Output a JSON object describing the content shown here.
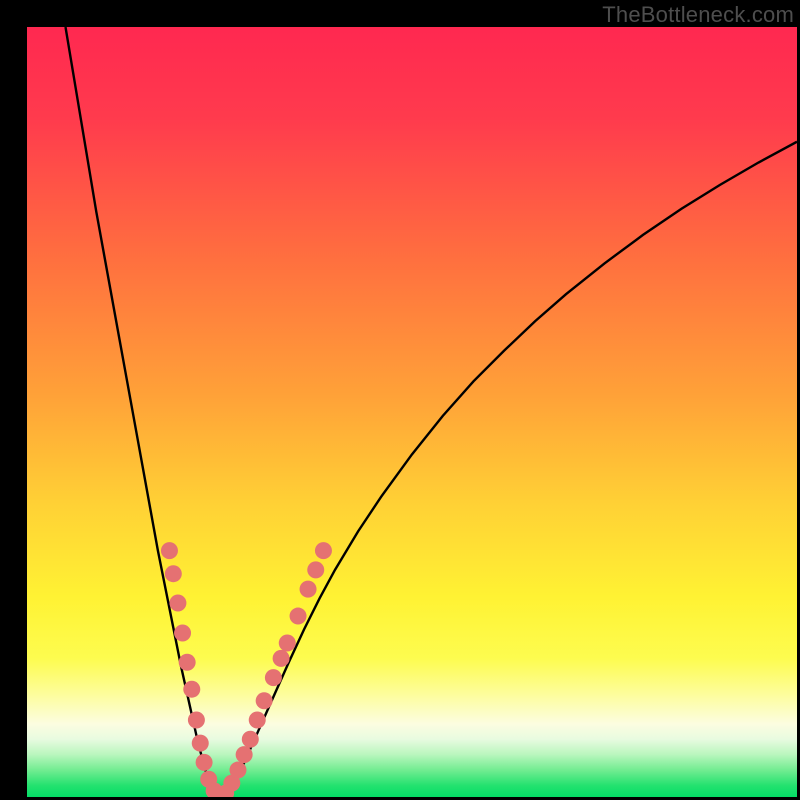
{
  "watermark": "TheBottleneck.com",
  "colors": {
    "frame": "#000000",
    "curve": "#000000",
    "marker": "#e57172",
    "gradient_stops": [
      {
        "offset": 0.0,
        "color": "#ff2850"
      },
      {
        "offset": 0.12,
        "color": "#ff3b4d"
      },
      {
        "offset": 0.3,
        "color": "#ff6f3f"
      },
      {
        "offset": 0.48,
        "color": "#ffa238"
      },
      {
        "offset": 0.62,
        "color": "#ffd135"
      },
      {
        "offset": 0.74,
        "color": "#fff233"
      },
      {
        "offset": 0.82,
        "color": "#fdfc4f"
      },
      {
        "offset": 0.865,
        "color": "#fdfd99"
      },
      {
        "offset": 0.905,
        "color": "#fcfde0"
      },
      {
        "offset": 0.925,
        "color": "#e8fbe0"
      },
      {
        "offset": 0.945,
        "color": "#b9f6bd"
      },
      {
        "offset": 0.965,
        "color": "#72ec91"
      },
      {
        "offset": 0.985,
        "color": "#24e26f"
      },
      {
        "offset": 1.0,
        "color": "#04dd66"
      }
    ]
  },
  "chart_data": {
    "type": "line",
    "title": "",
    "xlabel": "",
    "ylabel": "",
    "xlim": [
      0,
      100
    ],
    "ylim": [
      0,
      100
    ],
    "x": [
      5,
      6,
      7,
      8,
      9,
      10,
      11,
      12,
      13,
      14,
      15,
      16,
      17,
      18,
      19,
      20,
      21,
      22,
      23,
      24,
      25,
      26,
      28,
      30,
      32,
      34,
      36,
      38,
      40,
      43,
      46,
      50,
      54,
      58,
      62,
      66,
      70,
      75,
      80,
      85,
      90,
      95,
      100
    ],
    "values": [
      100,
      94,
      88,
      82,
      76,
      70.5,
      65,
      59.5,
      54,
      48.5,
      43,
      37.5,
      32,
      27,
      22,
      17,
      12.5,
      8,
      4,
      1,
      0,
      1,
      4,
      8.5,
      13,
      17.5,
      21.8,
      25.8,
      29.5,
      34.5,
      39,
      44.5,
      49.5,
      54,
      58,
      61.8,
      65.3,
      69.3,
      73,
      76.4,
      79.5,
      82.4,
      85.1
    ],
    "annotations": {
      "minimum_x": 25,
      "minimum_y": 0
    },
    "markers": [
      {
        "x": 18.5,
        "y": 32.0
      },
      {
        "x": 19.0,
        "y": 29.0
      },
      {
        "x": 19.6,
        "y": 25.2
      },
      {
        "x": 20.2,
        "y": 21.3
      },
      {
        "x": 20.8,
        "y": 17.5
      },
      {
        "x": 21.4,
        "y": 14.0
      },
      {
        "x": 22.0,
        "y": 10.0
      },
      {
        "x": 22.5,
        "y": 7.0
      },
      {
        "x": 23.0,
        "y": 4.5
      },
      {
        "x": 23.6,
        "y": 2.3
      },
      {
        "x": 24.3,
        "y": 0.8
      },
      {
        "x": 25.0,
        "y": 0.0
      },
      {
        "x": 25.8,
        "y": 0.5
      },
      {
        "x": 26.6,
        "y": 1.8
      },
      {
        "x": 27.4,
        "y": 3.5
      },
      {
        "x": 28.2,
        "y": 5.5
      },
      {
        "x": 29.0,
        "y": 7.5
      },
      {
        "x": 29.9,
        "y": 10.0
      },
      {
        "x": 30.8,
        "y": 12.5
      },
      {
        "x": 32.0,
        "y": 15.5
      },
      {
        "x": 33.0,
        "y": 18.0
      },
      {
        "x": 33.8,
        "y": 20.0
      },
      {
        "x": 35.2,
        "y": 23.5
      },
      {
        "x": 36.5,
        "y": 27.0
      },
      {
        "x": 37.5,
        "y": 29.5
      },
      {
        "x": 38.5,
        "y": 32.0
      }
    ]
  }
}
